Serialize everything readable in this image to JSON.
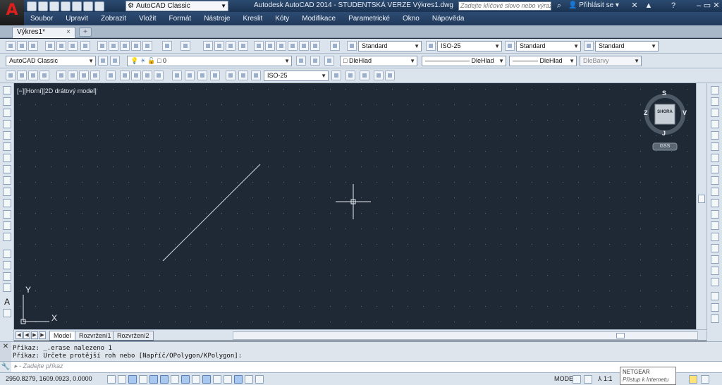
{
  "app": {
    "title": "Autodesk AutoCAD 2014 - STUDENTSKÁ VERZE   Výkres1.dwg",
    "workspace": "AutoCAD Classic",
    "search_placeholder": "Zadejte klíčové slovo nebo výraz.",
    "signin": "Přihlásit se",
    "logo_letter": "A"
  },
  "menu": [
    "Soubor",
    "Upravit",
    "Zobrazit",
    "Vložit",
    "Formát",
    "Nástroje",
    "Kreslit",
    "Kóty",
    "Modifikace",
    "Parametrické",
    "Okno",
    "Nápověda"
  ],
  "doc_tab": {
    "label": "Výkres1*",
    "close": "×"
  },
  "toolbar1": {
    "text_style": "Standard",
    "dim_style": "ISO-25",
    "table_style": "Standard",
    "mleader_style": "Standard"
  },
  "toolbar2": {
    "workspace": "AutoCAD Classic",
    "layer": "0",
    "color": "DleHlad",
    "linetype": "DleHlad",
    "lineweight": "DleHlad",
    "plotstyle": "DleBarvy"
  },
  "toolbar3": {
    "dim_style": "ISO-25"
  },
  "viewport": {
    "label": "[−][Horní][2D drátový model]",
    "viewcube": {
      "top": "SHORA",
      "north": "S",
      "south": "J",
      "east": "V",
      "west": "Z",
      "wcs": "GSS"
    },
    "ucs": {
      "x": "X",
      "y": "Y"
    }
  },
  "layout_tabs": [
    {
      "label": "Model",
      "active": true
    },
    {
      "label": "Rozvržení1",
      "active": false
    },
    {
      "label": "Rozvržení2",
      "active": false
    }
  ],
  "command": {
    "history": [
      "Příkaz: _.erase nalezeno 1",
      "Příkaz: Určete protější roh nebo [Napříč/OPolygon/KPolygon]:"
    ],
    "prompt": "Zadejte příkaz"
  },
  "status": {
    "coords": "2950.8279, 1609.0923, 0.0000",
    "space": "MODELP",
    "scale": "1:1"
  },
  "notification": {
    "title": "NETGEAR",
    "subtitle": "Přístup k Internetu"
  }
}
